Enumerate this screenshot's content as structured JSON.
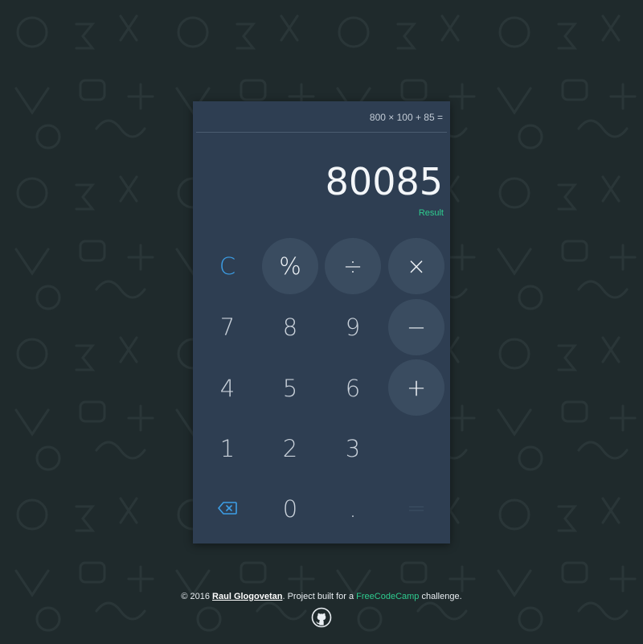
{
  "calculator": {
    "expression": "800 × 100 + 85 =",
    "display": "80085",
    "display_label": "Result",
    "keys": {
      "clear": "C",
      "percent": "%",
      "divide": "÷",
      "multiply": "×",
      "seven": "7",
      "eight": "8",
      "nine": "9",
      "minus": "−",
      "four": "4",
      "five": "5",
      "six": "6",
      "plus": "+",
      "one": "1",
      "two": "2",
      "three": "3",
      "backspace_icon": "backspace-icon",
      "zero": "0",
      "decimal": ".",
      "equals": "="
    }
  },
  "footer": {
    "copyright": "© 2016 ",
    "author": "Raul Glogovetan",
    "middle": ". Project built for a ",
    "fcc": "FreeCodeCamp",
    "end": " challenge.",
    "github_icon": "github-icon"
  },
  "colors": {
    "background": "#1f2a2c",
    "calculator": "#2e3e52",
    "accent_green": "#2ecc8f",
    "accent_blue": "#3c9ee6"
  }
}
